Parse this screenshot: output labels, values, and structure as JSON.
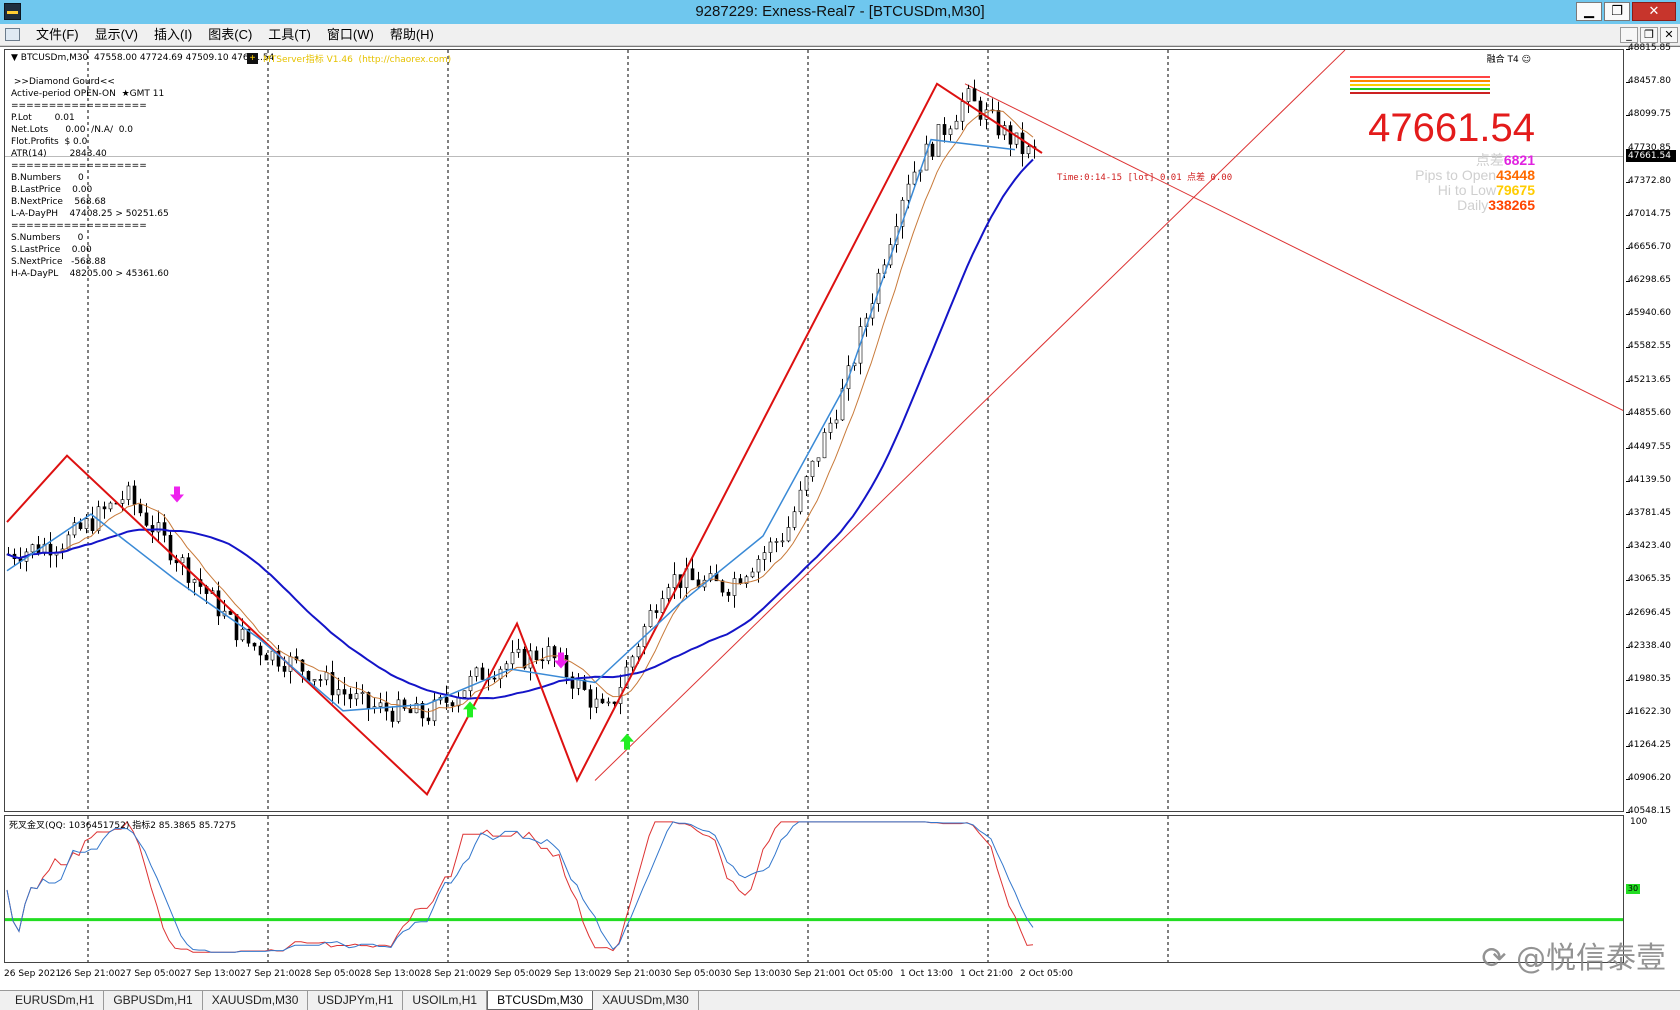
{
  "window": {
    "title": "9287229: Exness-Real7 - [BTCUSDm,M30]",
    "buttons": {
      "minimize": "▁",
      "restore": "❐",
      "close": "✕"
    }
  },
  "menu": {
    "items": [
      "文件(F)",
      "显示(V)",
      "插入(I)",
      "图表(C)",
      "工具(T)",
      "窗口(W)",
      "帮助(H)"
    ],
    "mdi_buttons": {
      "minimize": "_",
      "restore": "❐",
      "close": "✕"
    }
  },
  "chart_header": {
    "symbol_line": "▼ BTCUSDm,M30  47558.00 47724.69 47509.10 47661.54",
    "ea_name": "MTServer指标 V1.46  (http://chaorex.com)",
    "corner": "融合 T4 ☺"
  },
  "info_panel": {
    "lines": [
      " >>Diamond Gourd<<",
      "Active-period OPEN-ON  ★GMT 11",
      "==================",
      "P.Lot        0.01",
      "Net.Lots      0.00  /N.A/  0.0",
      "Flot.Profits  $ 0.0",
      "ATR(14)        2843.40",
      "==================",
      "B.Numbers      0",
      "B.LastPrice    0.00",
      "B.NextPrice    568.68",
      "L-A-DayPH    47408.25 > 50251.65",
      "==================",
      "S.Numbers      0",
      "S.LastPrice    0.00",
      "S.NextPrice   -568.88",
      "H-A-DayPL    48205.00 > 45361.60"
    ]
  },
  "price_panel": {
    "current_price": "47661.54",
    "stats": [
      {
        "label": "点差",
        "value": "6821",
        "color": "#e022e0"
      },
      {
        "label": "Pips to Open",
        "value": "43448",
        "color": "#ff6a00"
      },
      {
        "label": "Hi to Low",
        "value": "79675",
        "color": "#ffcc00"
      },
      {
        "label": "Daily",
        "value": "338265",
        "color": "#ff4400"
      }
    ],
    "timer": "Time:0:14-15 [lot] 0.01 点差 0.00"
  },
  "price_axis": {
    "labels": [
      "48815.85",
      "48457.80",
      "48099.75",
      "47730.85",
      "47372.80",
      "47014.75",
      "46656.70",
      "46298.65",
      "45940.60",
      "45582.55",
      "45213.65",
      "44855.60",
      "44497.55",
      "44139.50",
      "43781.45",
      "43423.40",
      "43065.35",
      "42696.45",
      "42338.40",
      "41980.35",
      "41622.30",
      "41264.25",
      "40906.20",
      "40548.15"
    ],
    "current_tag": "47661.54"
  },
  "oscillator": {
    "label": "死叉金叉(QQ: 1036451752) 指标2 85.3865 85.7275",
    "axis_top": "100",
    "level_tag": "30"
  },
  "time_axis": {
    "labels": [
      "26 Sep 2021",
      "26 Sep 21:00",
      "27 Sep 05:00",
      "27 Sep 13:00",
      "27 Sep 21:00",
      "28 Sep 05:00",
      "28 Sep 13:00",
      "28 Sep 21:00",
      "29 Sep 05:00",
      "29 Sep 13:00",
      "29 Sep 21:00",
      "30 Sep 05:00",
      "30 Sep 13:00",
      "30 Sep 21:00",
      "1 Oct 05:00",
      "1 Oct 13:00",
      "1 Oct 21:00",
      "2 Oct 05:00"
    ]
  },
  "watermark": "⟳ @悦信泰壹",
  "tabs": [
    "EURUSDm,H1",
    "GBPUSDm,H1",
    "XAUUSDm,M30",
    "USDJPYm,H1",
    "USOILm,H1",
    "BTCUSDm,M30",
    "XAUUSDm,M30"
  ],
  "active_tab": 5,
  "colors": {
    "bull_arrow": "#22ee22",
    "bear_arrow": "#ee22ee",
    "zigzag_red": "#dd1111",
    "zigzag_blue": "#3a8ad6",
    "ma_blue": "#1414c8",
    "ma_orange": "#c87a3a",
    "osc_level": "#22dd22"
  },
  "chart_data": {
    "type": "line",
    "x": [
      "26 Sep 2021",
      "26 Sep 21:00",
      "27 Sep 05:00",
      "27 Sep 13:00",
      "27 Sep 21:00",
      "28 Sep 05:00",
      "28 Sep 13:00",
      "28 Sep 21:00",
      "29 Sep 05:00",
      "29 Sep 13:00",
      "29 Sep 21:00",
      "30 Sep 05:00",
      "30 Sep 13:00",
      "30 Sep 21:00",
      "1 Oct 05:00",
      "1 Oct 13:00",
      "1 Oct 21:00",
      "2 Oct 05:00"
    ],
    "ylim": [
      40548.15,
      48815.85
    ],
    "series": [
      {
        "values": [
          43350,
          43500,
          44000,
          43200,
          42400,
          42100,
          41700,
          41600,
          42100,
          42300,
          41600,
          43100,
          43000,
          43600,
          45200,
          47400,
          48300,
          47700
        ]
      }
    ],
    "zigzag_red": [
      {
        "x": "26 Sep 2021",
        "y": 43700
      },
      {
        "x": "26 Sep 21:00",
        "y": 44420
      },
      {
        "x": "28 Sep 21:00",
        "y": 40750
      },
      {
        "x": "29 Sep 09:00",
        "y": 42600
      },
      {
        "x": "29 Sep 17:00",
        "y": 40900
      },
      {
        "x": "1 Oct 17:00",
        "y": 48450
      },
      {
        "x": "2 Oct 07:00",
        "y": 47700
      }
    ],
    "osc_level": 30,
    "osc_ylim": [
      0,
      100
    ]
  }
}
